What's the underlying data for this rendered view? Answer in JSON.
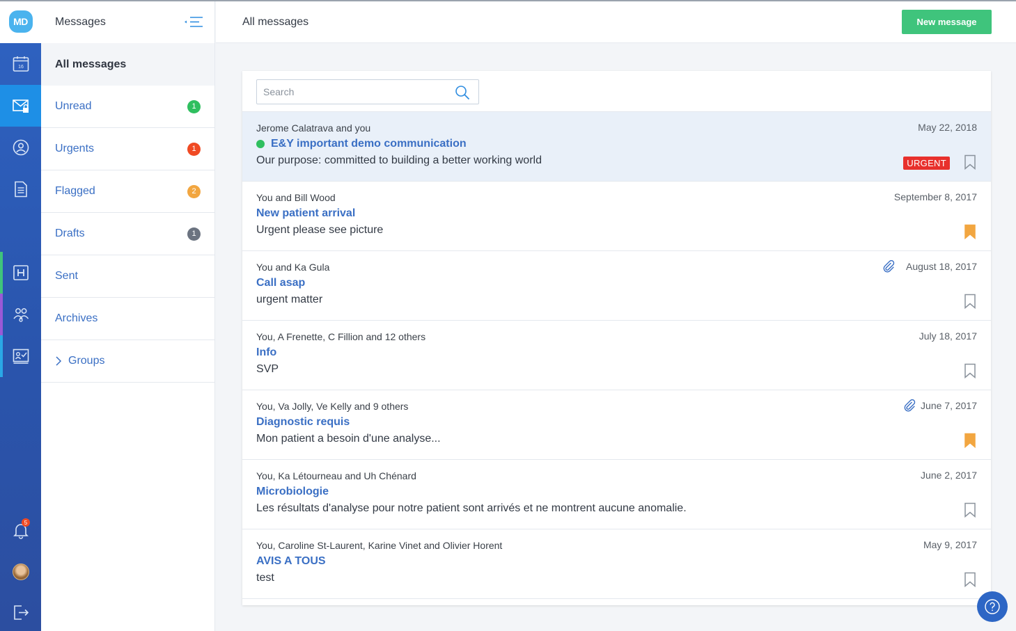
{
  "app": {
    "logo_text": "MD"
  },
  "rail": {
    "calendar_day": "16",
    "notifications_count": "5"
  },
  "sidebar": {
    "title": "Messages",
    "items": [
      {
        "label": "All messages",
        "count": null
      },
      {
        "label": "Unread",
        "count": "1",
        "count_color": "#2fbf5f"
      },
      {
        "label": "Urgents",
        "count": "1",
        "count_color": "#f04a23"
      },
      {
        "label": "Flagged",
        "count": "2",
        "count_color": "#f2a640"
      },
      {
        "label": "Drafts",
        "count": "1",
        "count_color": "#6b7380"
      },
      {
        "label": "Sent",
        "count": null
      },
      {
        "label": "Archives",
        "count": null
      },
      {
        "label": "Groups",
        "count": null
      }
    ]
  },
  "header": {
    "title": "All messages",
    "new_message_label": "New message"
  },
  "search": {
    "placeholder": "Search",
    "value": ""
  },
  "messages": [
    {
      "participants": "Jerome Calatrava and you",
      "subject": "E&Y important demo communication",
      "preview": "Our purpose: committed to building a better working world",
      "date": "May 22, 2018",
      "unread": true,
      "urgent_label": "URGENT",
      "flagged": false,
      "attachment": false
    },
    {
      "participants": "You and Bill Wood",
      "subject": "New patient arrival",
      "preview": "Urgent please see picture",
      "date": "September 8, 2017",
      "flagged": true,
      "attachment": false
    },
    {
      "participants": "You and Ka Gula",
      "subject": "Call asap",
      "preview": "urgent matter",
      "date": "August 18, 2017",
      "flagged": false,
      "attachment": true
    },
    {
      "participants": "You, A Frenette, C Fillion and 12 others",
      "subject": "Info",
      "preview": "SVP",
      "date": "July 18, 2017",
      "flagged": false,
      "attachment": false
    },
    {
      "participants": "You, Va Jolly, Ve Kelly and 9 others",
      "subject": "Diagnostic requis",
      "preview": "Mon patient a besoin d'une analyse...",
      "date": "June 7, 2017",
      "flagged": true,
      "attachment": true
    },
    {
      "participants": "You, Ka Létourneau and Uh Chénard",
      "subject": "Microbiologie",
      "preview": "Les résultats d'analyse pour notre patient sont arrivés et ne montrent aucune anomalie.",
      "date": "June 2, 2017",
      "flagged": false,
      "attachment": false
    },
    {
      "participants": "You, Caroline St-Laurent, Karine Vinet and Olivier Horent",
      "subject": "AVIS A TOUS",
      "preview": "test",
      "date": "May 9, 2017",
      "flagged": false,
      "attachment": false
    }
  ],
  "colors": {
    "accent_blue": "#3a6fc4",
    "rail_blue": "#2f63c2",
    "active_rail": "#1e8fe6",
    "new_button_green": "#3fc47c",
    "urgent_red": "#e8302c",
    "flag_orange": "#f2a640"
  }
}
